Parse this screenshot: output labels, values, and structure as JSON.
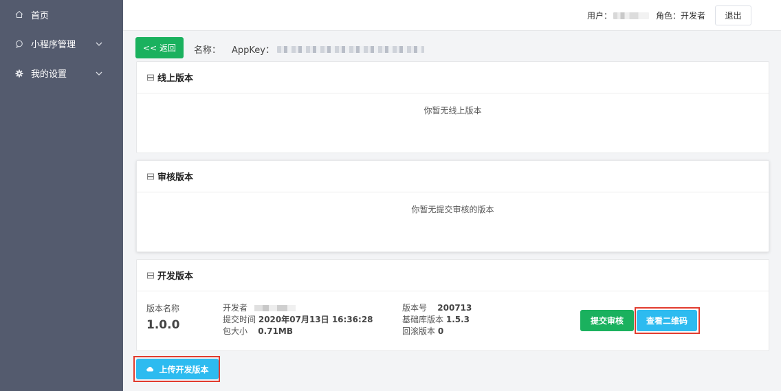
{
  "sidebar": {
    "items": [
      {
        "label": "首页",
        "icon": "home-icon"
      },
      {
        "label": "小程序管理",
        "icon": "chat-bubble-icon",
        "expandable": true
      },
      {
        "label": "我的设置",
        "icon": "gear-icon",
        "expandable": true
      }
    ]
  },
  "header": {
    "user_label": "用户：",
    "role_label": "角色：开发者",
    "logout": "退出"
  },
  "toolbar": {
    "back": "<< 返回",
    "name_label": "名称：",
    "appkey_label": "AppKey："
  },
  "online": {
    "title": "线上版本",
    "empty": "你暂无线上版本"
  },
  "review": {
    "title": "审核版本",
    "empty": "你暂无提交审核的版本"
  },
  "dev": {
    "title": "开发版本",
    "version_name_label": "版本名称",
    "version_name": "1.0.0",
    "developer_label": "开发者",
    "submit_time_label": "提交时间",
    "submit_time": "2020年07月13日 16:36:28",
    "size_label": "包大小",
    "size": "0.71MB",
    "version_no_label": "版本号",
    "version_no": "200713",
    "base_lib_label": "基础库版本",
    "base_lib": "1.5.3",
    "rollback_label": "回滚版本",
    "rollback": "0",
    "submit_review": "提交审核",
    "view_qr": "查看二维码"
  },
  "upload": {
    "label": "上传开发版本"
  },
  "colors": {
    "sidebar_bg": "#545b6e",
    "primary_green": "#1ab15e",
    "primary_blue": "#2dbbf0",
    "highlight_red": "#e23b2e"
  }
}
